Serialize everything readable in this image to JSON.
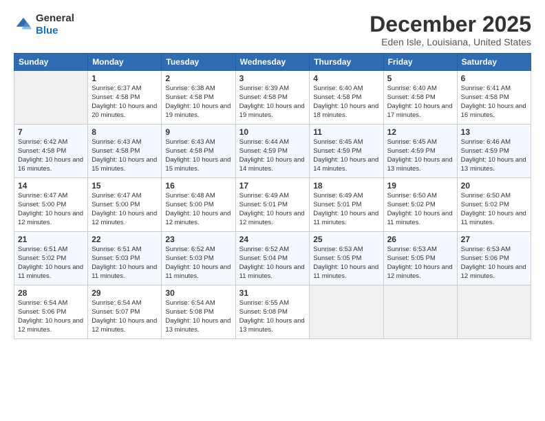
{
  "logo": {
    "general": "General",
    "blue": "Blue"
  },
  "title": "December 2025",
  "location": "Eden Isle, Louisiana, United States",
  "headers": [
    "Sunday",
    "Monday",
    "Tuesday",
    "Wednesday",
    "Thursday",
    "Friday",
    "Saturday"
  ],
  "weeks": [
    [
      {
        "day": "",
        "sunrise": "",
        "sunset": "",
        "daylight": "",
        "empty": true
      },
      {
        "day": "1",
        "sunrise": "Sunrise: 6:37 AM",
        "sunset": "Sunset: 4:58 PM",
        "daylight": "Daylight: 10 hours and 20 minutes."
      },
      {
        "day": "2",
        "sunrise": "Sunrise: 6:38 AM",
        "sunset": "Sunset: 4:58 PM",
        "daylight": "Daylight: 10 hours and 19 minutes."
      },
      {
        "day": "3",
        "sunrise": "Sunrise: 6:39 AM",
        "sunset": "Sunset: 4:58 PM",
        "daylight": "Daylight: 10 hours and 19 minutes."
      },
      {
        "day": "4",
        "sunrise": "Sunrise: 6:40 AM",
        "sunset": "Sunset: 4:58 PM",
        "daylight": "Daylight: 10 hours and 18 minutes."
      },
      {
        "day": "5",
        "sunrise": "Sunrise: 6:40 AM",
        "sunset": "Sunset: 4:58 PM",
        "daylight": "Daylight: 10 hours and 17 minutes."
      },
      {
        "day": "6",
        "sunrise": "Sunrise: 6:41 AM",
        "sunset": "Sunset: 4:58 PM",
        "daylight": "Daylight: 10 hours and 16 minutes."
      }
    ],
    [
      {
        "day": "7",
        "sunrise": "Sunrise: 6:42 AM",
        "sunset": "Sunset: 4:58 PM",
        "daylight": "Daylight: 10 hours and 16 minutes."
      },
      {
        "day": "8",
        "sunrise": "Sunrise: 6:43 AM",
        "sunset": "Sunset: 4:58 PM",
        "daylight": "Daylight: 10 hours and 15 minutes."
      },
      {
        "day": "9",
        "sunrise": "Sunrise: 6:43 AM",
        "sunset": "Sunset: 4:58 PM",
        "daylight": "Daylight: 10 hours and 15 minutes."
      },
      {
        "day": "10",
        "sunrise": "Sunrise: 6:44 AM",
        "sunset": "Sunset: 4:59 PM",
        "daylight": "Daylight: 10 hours and 14 minutes."
      },
      {
        "day": "11",
        "sunrise": "Sunrise: 6:45 AM",
        "sunset": "Sunset: 4:59 PM",
        "daylight": "Daylight: 10 hours and 14 minutes."
      },
      {
        "day": "12",
        "sunrise": "Sunrise: 6:45 AM",
        "sunset": "Sunset: 4:59 PM",
        "daylight": "Daylight: 10 hours and 13 minutes."
      },
      {
        "day": "13",
        "sunrise": "Sunrise: 6:46 AM",
        "sunset": "Sunset: 4:59 PM",
        "daylight": "Daylight: 10 hours and 13 minutes."
      }
    ],
    [
      {
        "day": "14",
        "sunrise": "Sunrise: 6:47 AM",
        "sunset": "Sunset: 5:00 PM",
        "daylight": "Daylight: 10 hours and 12 minutes."
      },
      {
        "day": "15",
        "sunrise": "Sunrise: 6:47 AM",
        "sunset": "Sunset: 5:00 PM",
        "daylight": "Daylight: 10 hours and 12 minutes."
      },
      {
        "day": "16",
        "sunrise": "Sunrise: 6:48 AM",
        "sunset": "Sunset: 5:00 PM",
        "daylight": "Daylight: 10 hours and 12 minutes."
      },
      {
        "day": "17",
        "sunrise": "Sunrise: 6:49 AM",
        "sunset": "Sunset: 5:01 PM",
        "daylight": "Daylight: 10 hours and 12 minutes."
      },
      {
        "day": "18",
        "sunrise": "Sunrise: 6:49 AM",
        "sunset": "Sunset: 5:01 PM",
        "daylight": "Daylight: 10 hours and 11 minutes."
      },
      {
        "day": "19",
        "sunrise": "Sunrise: 6:50 AM",
        "sunset": "Sunset: 5:02 PM",
        "daylight": "Daylight: 10 hours and 11 minutes."
      },
      {
        "day": "20",
        "sunrise": "Sunrise: 6:50 AM",
        "sunset": "Sunset: 5:02 PM",
        "daylight": "Daylight: 10 hours and 11 minutes."
      }
    ],
    [
      {
        "day": "21",
        "sunrise": "Sunrise: 6:51 AM",
        "sunset": "Sunset: 5:02 PM",
        "daylight": "Daylight: 10 hours and 11 minutes."
      },
      {
        "day": "22",
        "sunrise": "Sunrise: 6:51 AM",
        "sunset": "Sunset: 5:03 PM",
        "daylight": "Daylight: 10 hours and 11 minutes."
      },
      {
        "day": "23",
        "sunrise": "Sunrise: 6:52 AM",
        "sunset": "Sunset: 5:03 PM",
        "daylight": "Daylight: 10 hours and 11 minutes."
      },
      {
        "day": "24",
        "sunrise": "Sunrise: 6:52 AM",
        "sunset": "Sunset: 5:04 PM",
        "daylight": "Daylight: 10 hours and 11 minutes."
      },
      {
        "day": "25",
        "sunrise": "Sunrise: 6:53 AM",
        "sunset": "Sunset: 5:05 PM",
        "daylight": "Daylight: 10 hours and 11 minutes."
      },
      {
        "day": "26",
        "sunrise": "Sunrise: 6:53 AM",
        "sunset": "Sunset: 5:05 PM",
        "daylight": "Daylight: 10 hours and 12 minutes."
      },
      {
        "day": "27",
        "sunrise": "Sunrise: 6:53 AM",
        "sunset": "Sunset: 5:06 PM",
        "daylight": "Daylight: 10 hours and 12 minutes."
      }
    ],
    [
      {
        "day": "28",
        "sunrise": "Sunrise: 6:54 AM",
        "sunset": "Sunset: 5:06 PM",
        "daylight": "Daylight: 10 hours and 12 minutes."
      },
      {
        "day": "29",
        "sunrise": "Sunrise: 6:54 AM",
        "sunset": "Sunset: 5:07 PM",
        "daylight": "Daylight: 10 hours and 12 minutes."
      },
      {
        "day": "30",
        "sunrise": "Sunrise: 6:54 AM",
        "sunset": "Sunset: 5:08 PM",
        "daylight": "Daylight: 10 hours and 13 minutes."
      },
      {
        "day": "31",
        "sunrise": "Sunrise: 6:55 AM",
        "sunset": "Sunset: 5:08 PM",
        "daylight": "Daylight: 10 hours and 13 minutes."
      },
      {
        "day": "",
        "sunrise": "",
        "sunset": "",
        "daylight": "",
        "empty": true
      },
      {
        "day": "",
        "sunrise": "",
        "sunset": "",
        "daylight": "",
        "empty": true
      },
      {
        "day": "",
        "sunrise": "",
        "sunset": "",
        "daylight": "",
        "empty": true
      }
    ]
  ]
}
